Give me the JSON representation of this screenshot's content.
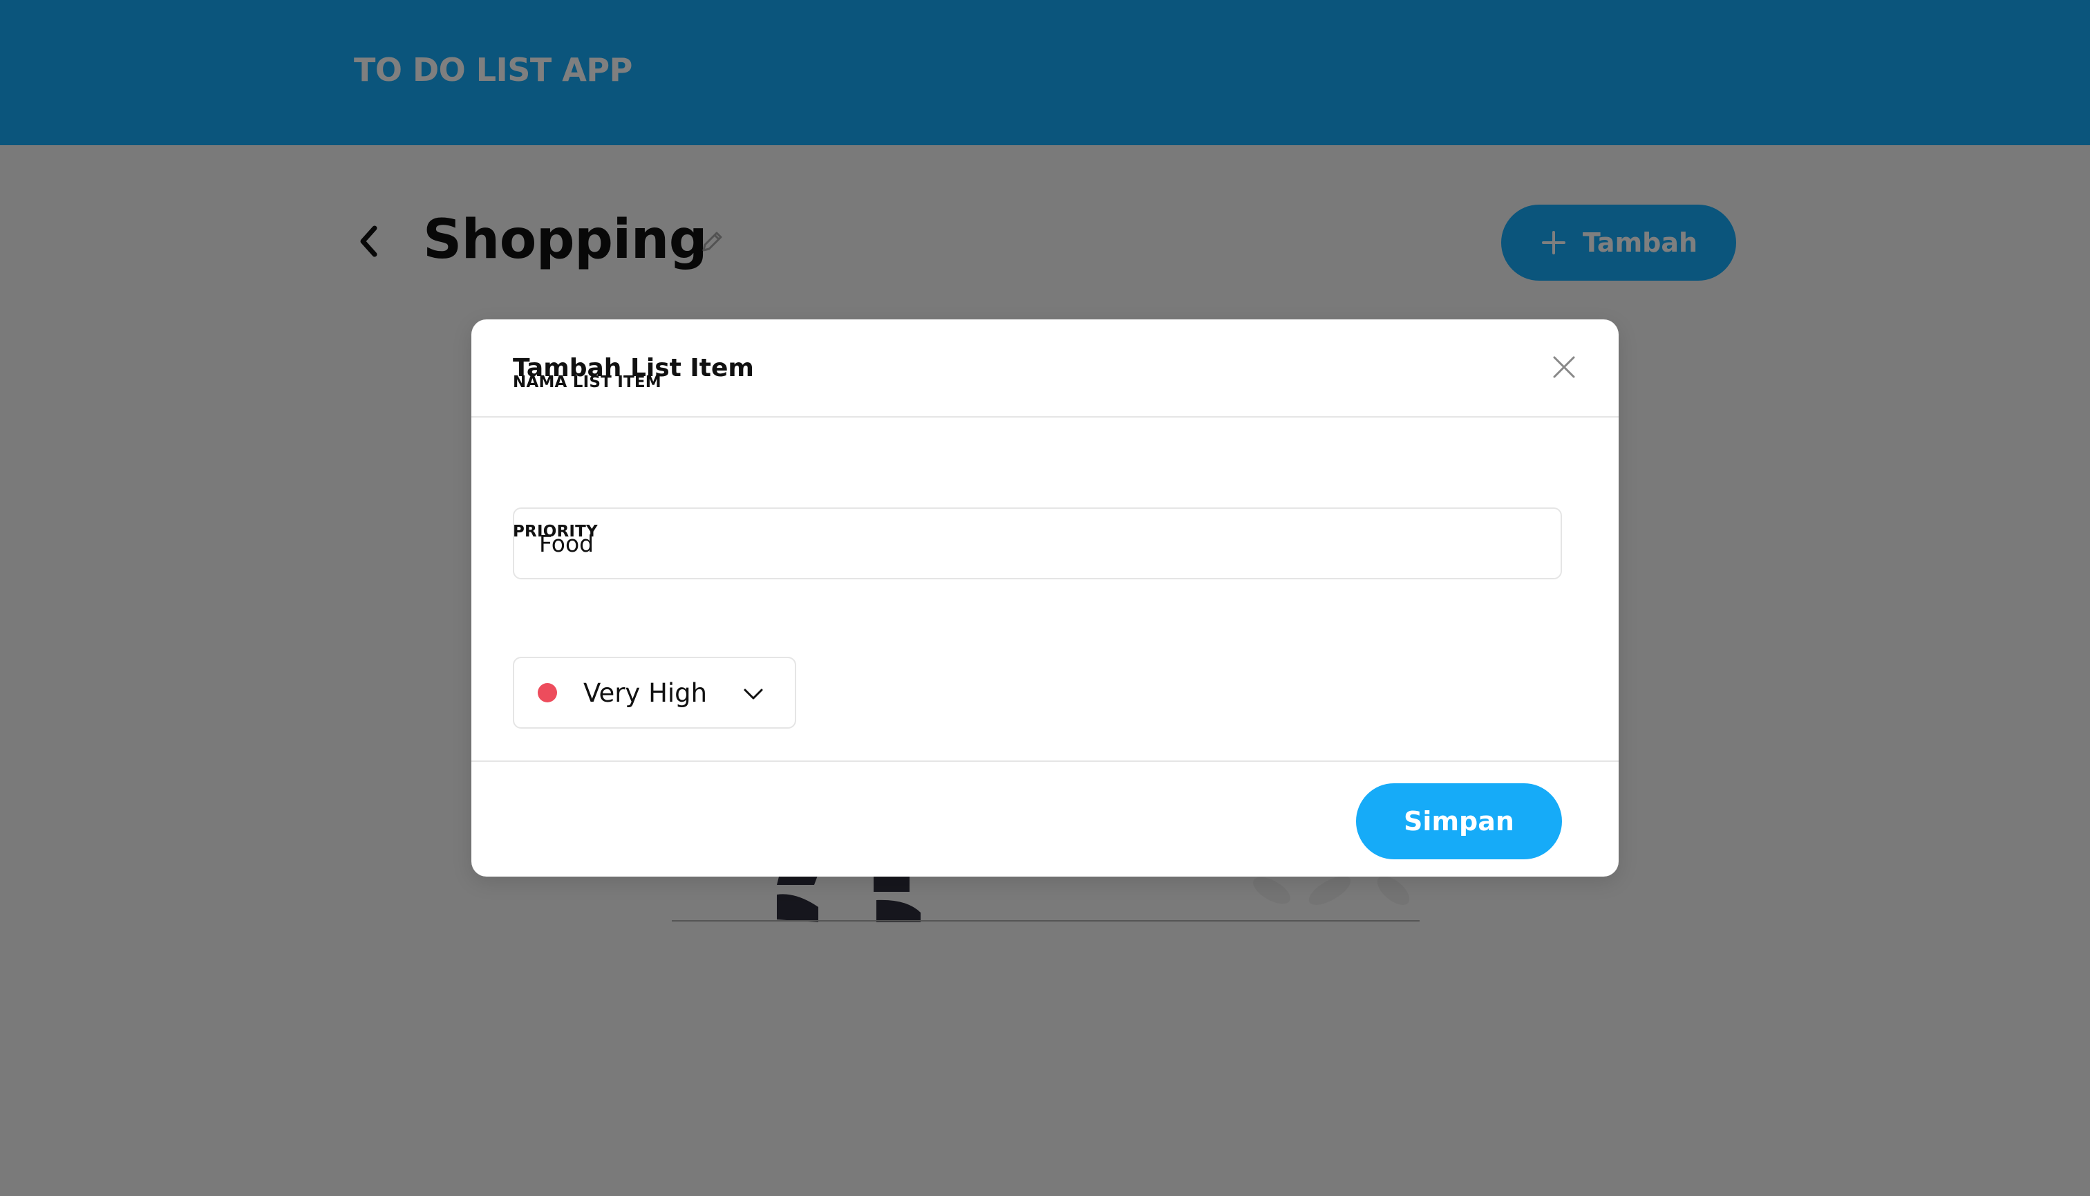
{
  "header": {
    "app_title": "TO DO LIST APP"
  },
  "page": {
    "title": "Shopping",
    "add_button_label": "Tambah"
  },
  "modal": {
    "title": "Tambah List Item",
    "name_field": {
      "label": "NAMA LIST ITEM",
      "value": "Food"
    },
    "priority_field": {
      "label": "PRIORITY",
      "selected": "Very High",
      "selected_color": "#ed4c5c"
    },
    "save_button_label": "Simpan"
  },
  "colors": {
    "primary": "#16abf8",
    "header": "#16abf8",
    "overlay": "rgba(0,0,0,0.5)"
  },
  "icons": {
    "back": "chevron-left-icon",
    "edit": "pencil-icon",
    "add": "plus-icon",
    "close": "close-icon",
    "dropdown": "chevron-down-icon"
  }
}
